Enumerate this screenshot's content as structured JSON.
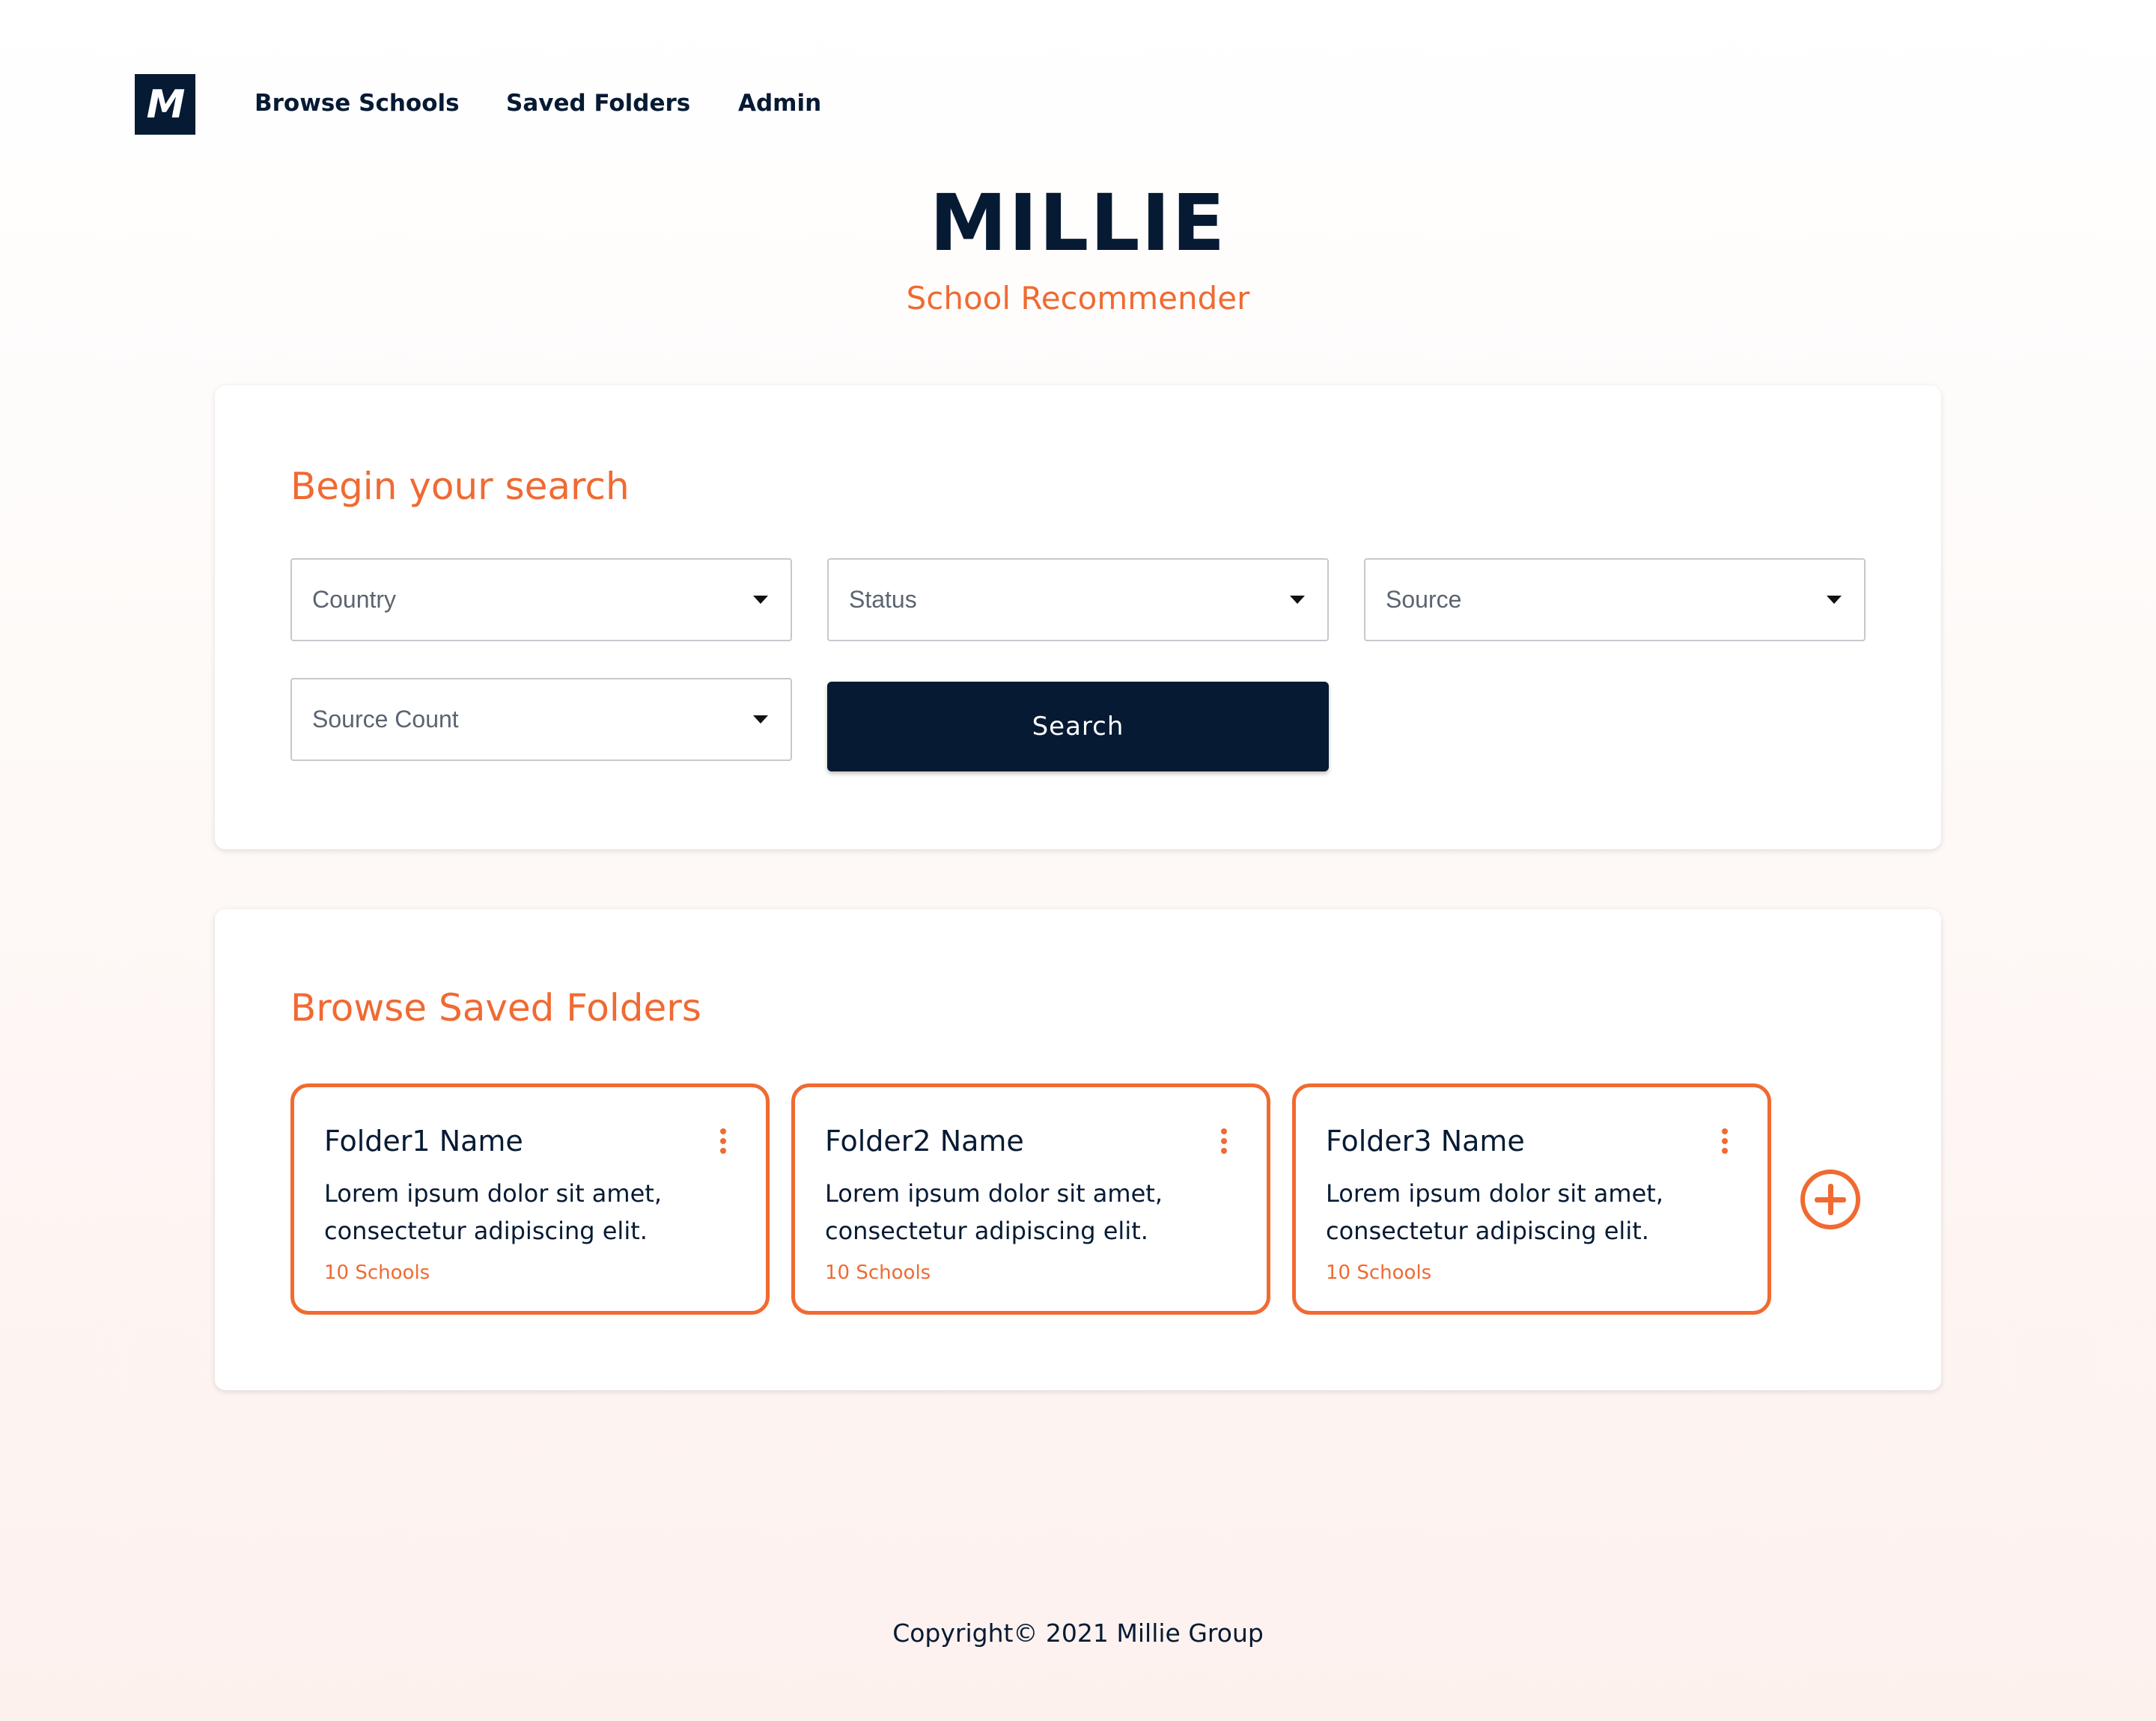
{
  "nav": {
    "logo_letter": "M",
    "links": [
      "Browse Schools",
      "Saved Folders",
      "Admin"
    ]
  },
  "hero": {
    "title": "MILLIE",
    "subtitle": "School Recommender"
  },
  "search": {
    "title": "Begin your search",
    "filters": {
      "country": "Country",
      "status": "Status",
      "source": "Source",
      "source_count": "Source Count"
    },
    "button_label": "Search"
  },
  "folders": {
    "title": "Browse Saved Folders",
    "items": [
      {
        "name": "Folder1 Name",
        "description": "Lorem ipsum dolor sit amet, consectetur adipiscing elit.",
        "count": "10 Schools"
      },
      {
        "name": "Folder2 Name",
        "description": "Lorem ipsum dolor sit amet, consectetur adipiscing elit.",
        "count": "10 Schools"
      },
      {
        "name": "Folder3 Name",
        "description": "Lorem ipsum dolor sit amet, consectetur adipiscing elit.",
        "count": "10 Schools"
      }
    ]
  },
  "footer": {
    "copyright": "Copyright© 2021 Millie Group"
  },
  "colors": {
    "navy": "#061a33",
    "accent": "#f06a32"
  },
  "icons": {
    "dropdown": "caret-down-icon",
    "menu": "kebab-menu-icon",
    "add": "plus-circle-icon"
  }
}
